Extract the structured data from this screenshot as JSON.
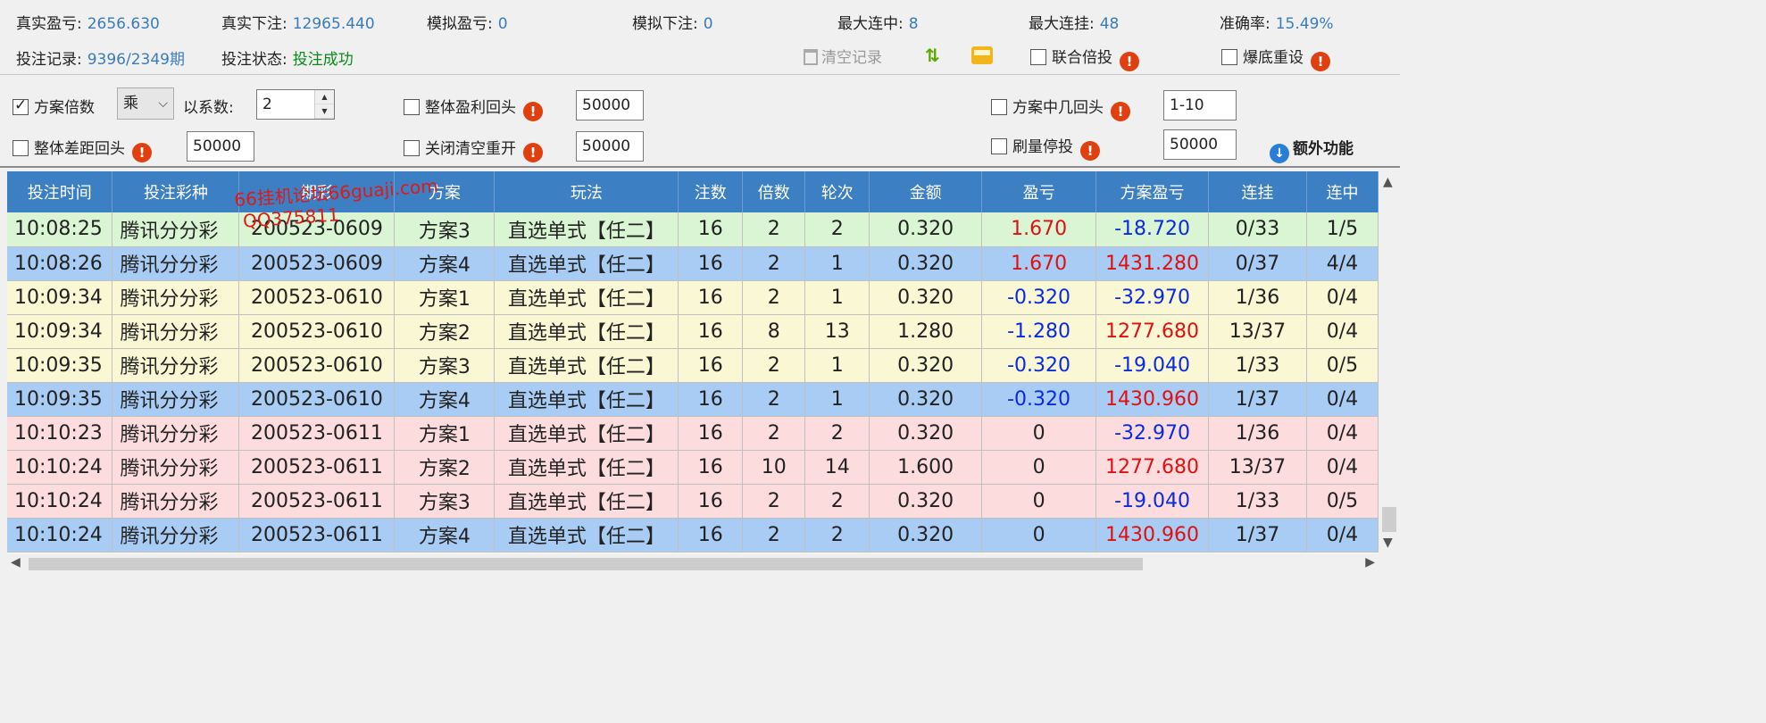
{
  "stats": {
    "real_pnl_label": "真实盈亏:",
    "real_pnl": "2656.630",
    "real_bet_label": "真实下注:",
    "real_bet": "12965.440",
    "sim_pnl_label": "模拟盈亏:",
    "sim_pnl": "0",
    "sim_bet_label": "模拟下注:",
    "sim_bet": "0",
    "max_win_streak_label": "最大连中:",
    "max_win_streak": "8",
    "max_loss_streak_label": "最大连挂:",
    "max_loss_streak": "48",
    "accuracy_label": "准确率:",
    "accuracy": "15.49%",
    "record_label": "投注记录:",
    "record": "9396/2349期",
    "status_label": "投注状态:",
    "status": "投注成功",
    "clear_label": "清空记录",
    "joint_multiplier_label": "联合倍投",
    "bust_reset_label": "爆底重设"
  },
  "options": {
    "plan_multiplier_label": "方案倍数",
    "op_value": "乘",
    "coef_label": "以系数:",
    "coef_value": "2",
    "overall_profit_return_label": "整体盈利回头",
    "overall_profit_return_value": "50000",
    "plan_hit_return_label": "方案中几回头",
    "plan_hit_return_value": "1-10",
    "overall_gap_return_label": "整体差距回头",
    "overall_gap_return_value": "50000",
    "close_clear_restart_label": "关闭清空重开",
    "close_clear_restart_value": "50000",
    "volume_stop_label": "刷量停投",
    "volume_stop_value": "50000",
    "extra_label": "额外功能"
  },
  "watermark": {
    "line1": "66挂机论坛66guaji.com",
    "line2": "QQ375811"
  },
  "table": {
    "headers": [
      "投注时间",
      "投注彩种",
      "期彩",
      "方案",
      "玩法",
      "注数",
      "倍数",
      "轮次",
      "金额",
      "盈亏",
      "方案盈亏",
      "连挂",
      "连中"
    ],
    "rows": [
      {
        "style": "g",
        "cells": [
          "10:08:25",
          "腾讯分分彩",
          "200523-0609",
          "方案3",
          "直选单式【任二】",
          "16",
          "2",
          "2",
          "0.320",
          "1.670",
          "-18.720",
          "0/33",
          "1/5"
        ],
        "pnl_color": "red",
        "plan_color": "blue"
      },
      {
        "style": "b",
        "cells": [
          "10:08:26",
          "腾讯分分彩",
          "200523-0609",
          "方案4",
          "直选单式【任二】",
          "16",
          "2",
          "1",
          "0.320",
          "1.670",
          "1431.280",
          "0/37",
          "4/4"
        ],
        "pnl_color": "red",
        "plan_color": "red"
      },
      {
        "style": "y",
        "cells": [
          "10:09:34",
          "腾讯分分彩",
          "200523-0610",
          "方案1",
          "直选单式【任二】",
          "16",
          "2",
          "1",
          "0.320",
          "-0.320",
          "-32.970",
          "1/36",
          "0/4"
        ],
        "pnl_color": "blue",
        "plan_color": "blue"
      },
      {
        "style": "y",
        "cells": [
          "10:09:34",
          "腾讯分分彩",
          "200523-0610",
          "方案2",
          "直选单式【任二】",
          "16",
          "8",
          "13",
          "1.280",
          "-1.280",
          "1277.680",
          "13/37",
          "0/4"
        ],
        "pnl_color": "blue",
        "plan_color": "red"
      },
      {
        "style": "y",
        "cells": [
          "10:09:35",
          "腾讯分分彩",
          "200523-0610",
          "方案3",
          "直选单式【任二】",
          "16",
          "2",
          "1",
          "0.320",
          "-0.320",
          "-19.040",
          "1/33",
          "0/5"
        ],
        "pnl_color": "blue",
        "plan_color": "blue"
      },
      {
        "style": "b",
        "cells": [
          "10:09:35",
          "腾讯分分彩",
          "200523-0610",
          "方案4",
          "直选单式【任二】",
          "16",
          "2",
          "1",
          "0.320",
          "-0.320",
          "1430.960",
          "1/37",
          "0/4"
        ],
        "pnl_color": "blue",
        "plan_color": "red"
      },
      {
        "style": "p",
        "cells": [
          "10:10:23",
          "腾讯分分彩",
          "200523-0611",
          "方案1",
          "直选单式【任二】",
          "16",
          "2",
          "2",
          "0.320",
          "0",
          "-32.970",
          "1/36",
          "0/4"
        ],
        "pnl_color": "",
        "plan_color": "blue"
      },
      {
        "style": "p",
        "cells": [
          "10:10:24",
          "腾讯分分彩",
          "200523-0611",
          "方案2",
          "直选单式【任二】",
          "16",
          "10",
          "14",
          "1.600",
          "0",
          "1277.680",
          "13/37",
          "0/4"
        ],
        "pnl_color": "",
        "plan_color": "red"
      },
      {
        "style": "p",
        "cells": [
          "10:10:24",
          "腾讯分分彩",
          "200523-0611",
          "方案3",
          "直选单式【任二】",
          "16",
          "2",
          "2",
          "0.320",
          "0",
          "-19.040",
          "1/33",
          "0/5"
        ],
        "pnl_color": "",
        "plan_color": "blue"
      },
      {
        "style": "b",
        "cells": [
          "10:10:24",
          "腾讯分分彩",
          "200523-0611",
          "方案4",
          "直选单式【任二】",
          "16",
          "2",
          "2",
          "0.320",
          "0",
          "1430.960",
          "1/37",
          "0/4"
        ],
        "pnl_color": "",
        "plan_color": "red"
      }
    ]
  },
  "colors": {
    "header_bg": "#3c7fc2",
    "row_green": "#d9f5d3",
    "row_blue": "#a8ccf3",
    "row_yellow": "#f9f7d4",
    "row_pink": "#fcdcdc",
    "positive": "#e01010",
    "negative": "#0a2ae0"
  }
}
